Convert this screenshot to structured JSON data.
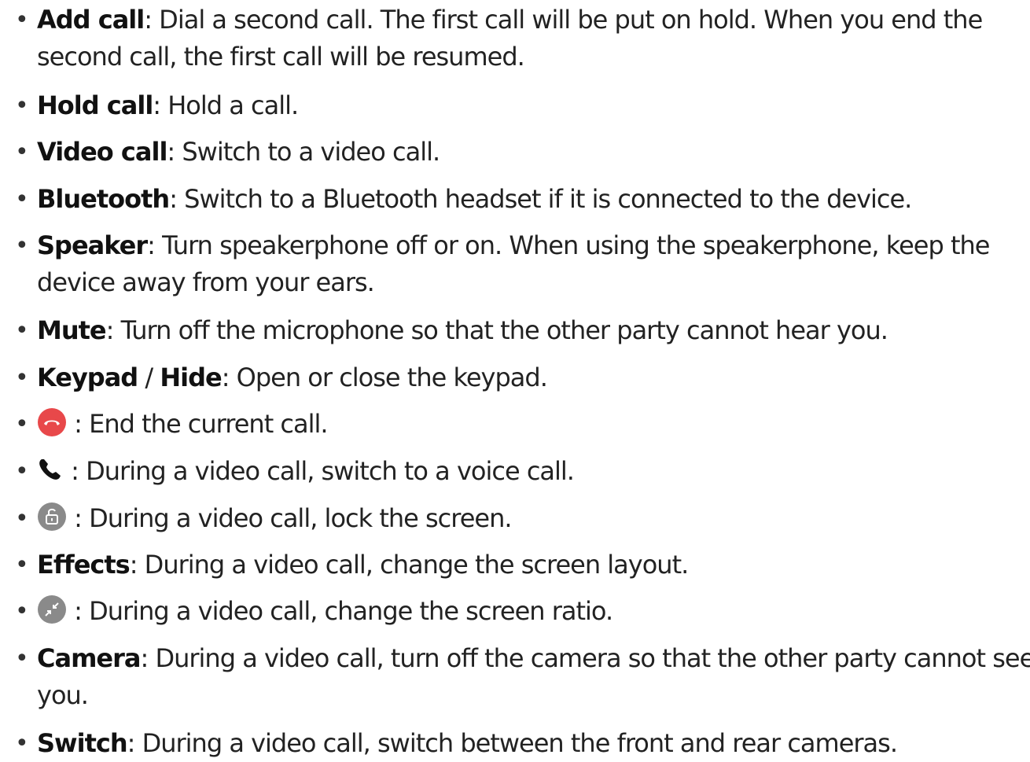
{
  "items": [
    {
      "term": "Add call",
      "line1": ": Dial a second call. The first call will be put on hold. When you end the",
      "line2": "second call, the first call will be resumed."
    },
    {
      "term": "Hold call",
      "text": ": Hold a call."
    },
    {
      "term": "Video call",
      "text": ": Switch to a video call."
    },
    {
      "term": "Bluetooth",
      "text": ": Switch to a Bluetooth headset if it is connected to the device."
    },
    {
      "term": "Speaker",
      "line1": ": Turn speakerphone off or on. When using the speakerphone, keep the",
      "line2": "device away from your ears."
    },
    {
      "term": "Mute",
      "text": ": Turn off the microphone so that the other party cannot hear you."
    },
    {
      "term": "Keypad",
      "sep": " / ",
      "term2": "Hide",
      "text": ": Open or close the keypad."
    },
    {
      "icon": "end-call-icon",
      "text": " : End the current call."
    },
    {
      "icon": "phone-icon",
      "text": " : During a video call, switch to a voice call."
    },
    {
      "icon": "unlock-icon",
      "text": " : During a video call, lock the screen."
    },
    {
      "term": "Effects",
      "text": ": During a video call, change the screen layout."
    },
    {
      "icon": "screen-ratio-icon",
      "text": " : During a video call, change the screen ratio."
    },
    {
      "term": "Camera",
      "line1": ": During a video call, turn off the camera so that the other party cannot see",
      "line2": "you."
    },
    {
      "term": "Switch",
      "text": ": During a video call, switch between the front and rear cameras."
    }
  ],
  "bullet": "•",
  "colors": {
    "end_call": "#E8484A",
    "icon_gray": "#8A8A8A",
    "text": "#222222"
  }
}
